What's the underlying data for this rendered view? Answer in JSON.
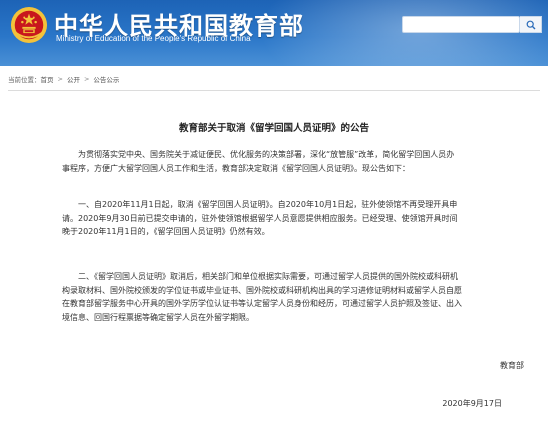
{
  "header": {
    "title": "中华人民共和国教育部",
    "subtitle": "Ministry of Education of the People's Republic of China",
    "search_placeholder": ""
  },
  "breadcrumb": {
    "prefix": "当前位置：",
    "items": [
      "首页",
      "公开",
      "公告公示"
    ]
  },
  "article": {
    "title": "教育部关于取消《留学回国人员证明》的公告",
    "paragraphs": [
      {
        "lines": [
          "为贯彻落实党中央、国务院关于减证便民、优化服务的决策部署，深化“放管服”改革，简化留学回国人员办",
          "事程序，方便广大留学回国人员工作和生活，教育部决定取消《留学回国人员证明》。现公告如下："
        ]
      },
      {
        "lines": [
          "一、自2020年11月1日起，取消《留学回国人员证明》。自2020年10月1日起，驻外使领馆不再受理开具申",
          "请。2020年9月30日前已提交申请的，驻外使领馆根据留学人员意愿提供相应服务。已经受理、使领馆开具时间",
          "晚于2020年11月1日的，《留学回国人员证明》仍然有效。"
        ]
      },
      {
        "lines": [
          "二、《留学回国人员证明》取消后，相关部门和单位根据实际需要，可通过留学人员提供的国外院校或科研机",
          "构录取材料、国外院校颁发的学位证书或毕业证书、国外院校或科研机构出具的学习进修证明材料或留学人员自愿",
          "在教育部留学服务中心开具的国外学历学位认证书等认定留学人员身份和经历，可通过留学人员护照及签证、出入",
          "境信息、回国行程票据等确定留学人员在外留学期限。"
        ]
      }
    ],
    "signature": "教育部",
    "date": "2020年9月17日"
  },
  "colors": {
    "header_blue": "#1d63b6",
    "emblem_red": "#c8161d",
    "emblem_gold": "#f3c23a"
  },
  "icons": {
    "emblem": "national-emblem-icon",
    "search": "search-icon"
  }
}
